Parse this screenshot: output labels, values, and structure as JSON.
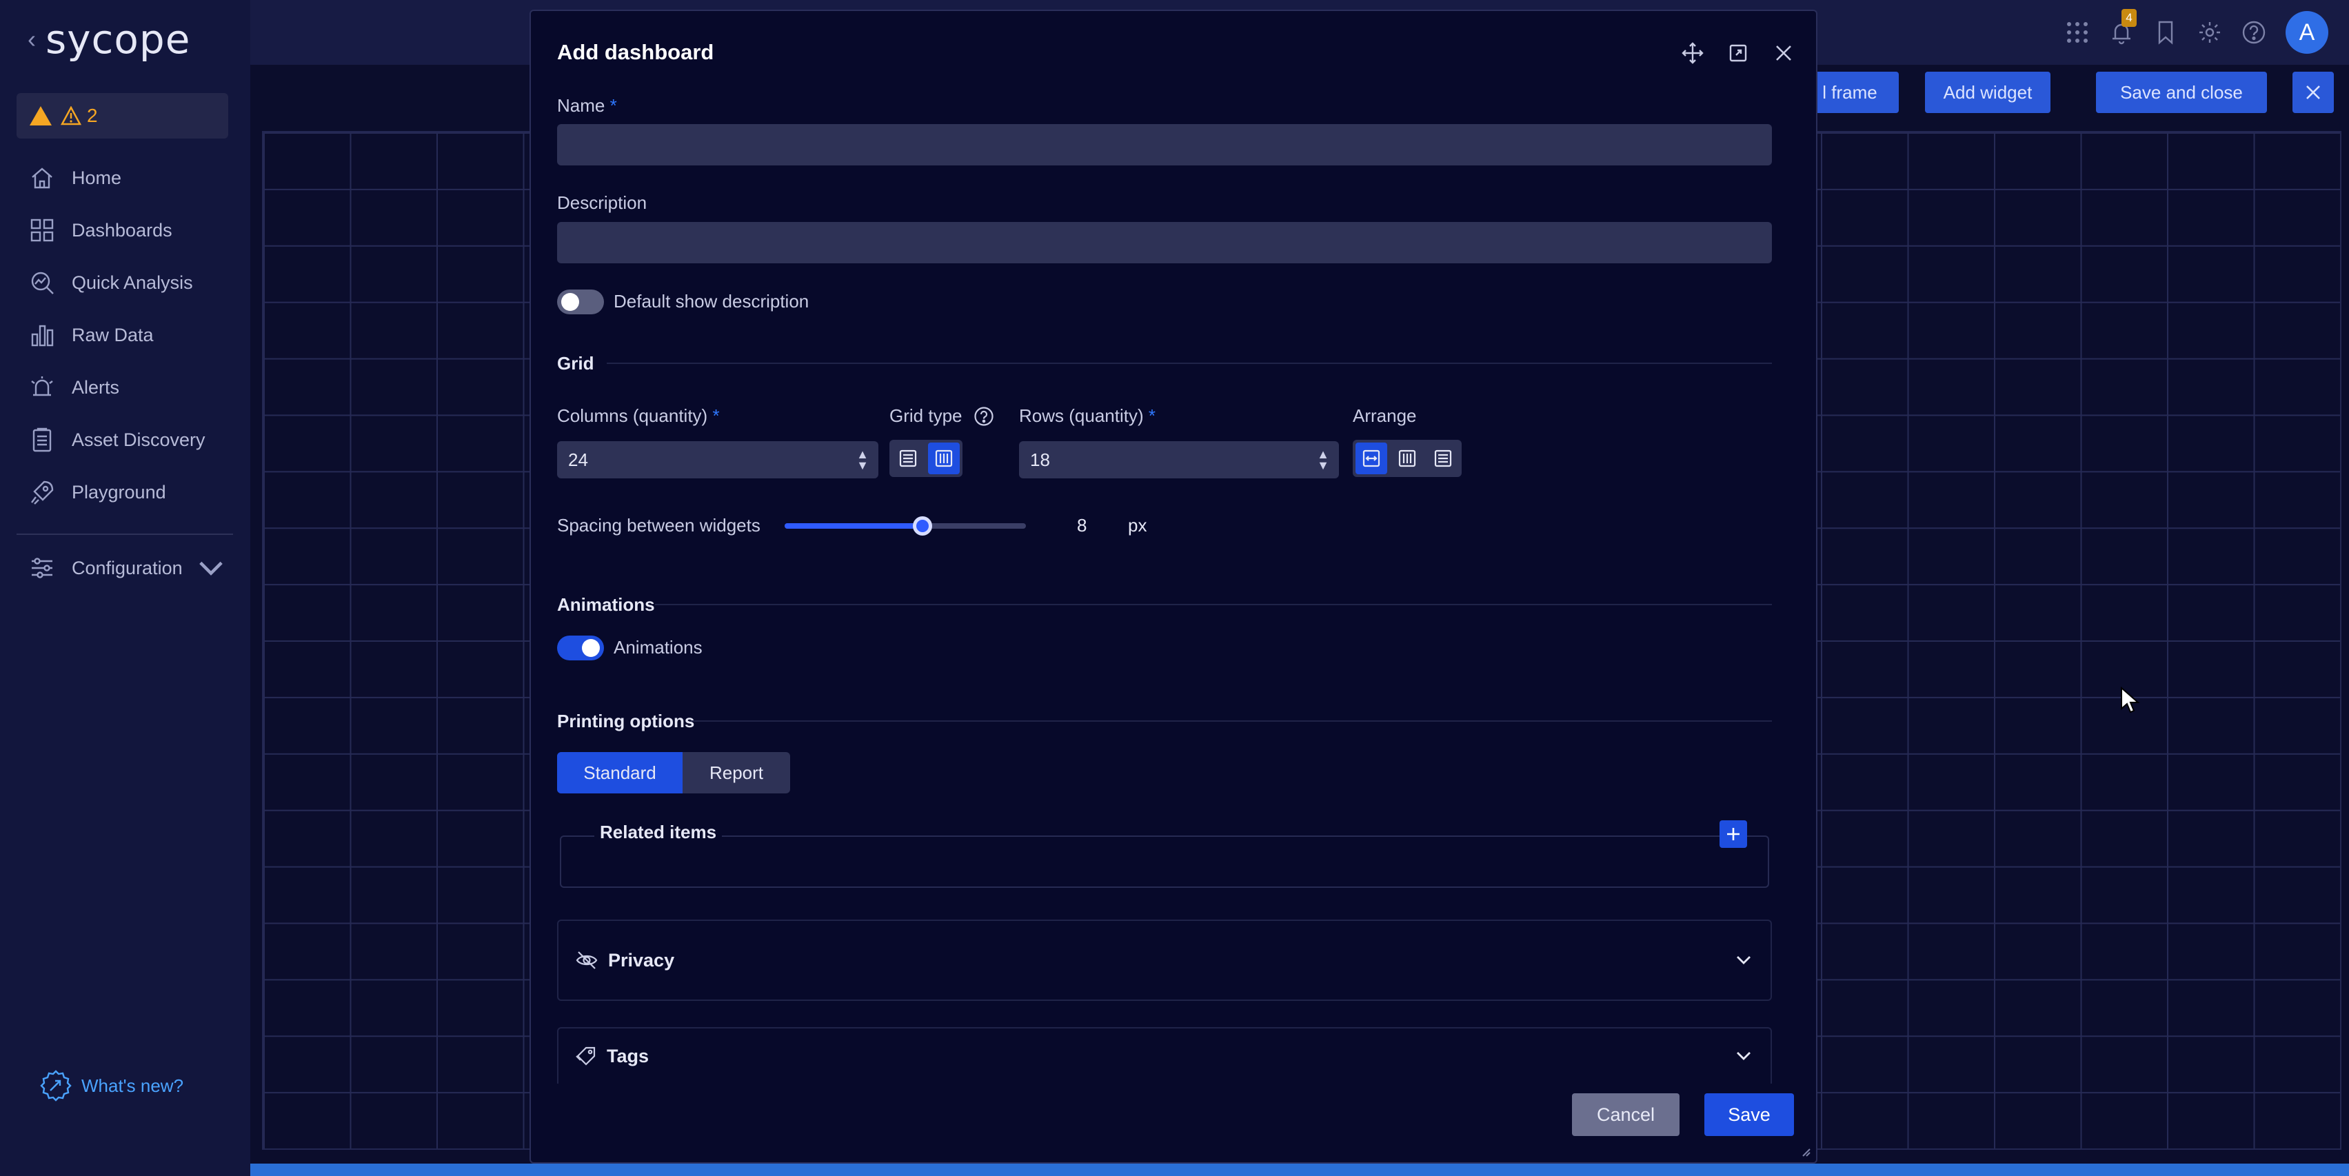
{
  "app": {
    "logo_text": "sycope",
    "alert_count": "2",
    "notification_count": "4",
    "avatar_letter": "A"
  },
  "sidebar": {
    "items": [
      {
        "label": "Home",
        "icon": "home-icon"
      },
      {
        "label": "Dashboards",
        "icon": "dashboards-icon"
      },
      {
        "label": "Quick Analysis",
        "icon": "quick-analysis-icon"
      },
      {
        "label": "Raw Data",
        "icon": "raw-data-icon"
      },
      {
        "label": "Alerts",
        "icon": "alert-bell-icon"
      },
      {
        "label": "Asset Discovery",
        "icon": "asset-discovery-icon"
      },
      {
        "label": "Playground",
        "icon": "rocket-icon"
      }
    ],
    "configuration_label": "Configuration",
    "whats_new_label": "What's new?"
  },
  "toolbar": {
    "frame_label": "l frame",
    "add_widget_label": "Add widget",
    "save_close_label": "Save and close"
  },
  "modal": {
    "title": "Add dashboard",
    "name_label": "Name",
    "name_value": "",
    "description_label": "Description",
    "description_value": "",
    "default_show_description_label": "Default show description",
    "default_show_description_on": false,
    "grid_section": "Grid",
    "columns_label": "Columns (quantity)",
    "columns_value": "24",
    "grid_type_label": "Grid type",
    "rows_label": "Rows (quantity)",
    "rows_value": "18",
    "arrange_label": "Arrange",
    "spacing_label": "Spacing between widgets",
    "spacing_value": "8",
    "spacing_unit": "px",
    "spacing_fraction": 0.57,
    "animations_section": "Animations",
    "animations_label": "Animations",
    "animations_on": true,
    "printing_section": "Printing options",
    "printing_options": [
      "Standard",
      "Report"
    ],
    "printing_selected": "Standard",
    "related_items_label": "Related items",
    "privacy_label": "Privacy",
    "tags_label": "Tags",
    "cancel_label": "Cancel",
    "save_label": "Save"
  },
  "colors": {
    "accent": "#1e4ee0",
    "background": "#0b0d2c",
    "sidebar": "#12163d",
    "warning": "#f5a623"
  }
}
